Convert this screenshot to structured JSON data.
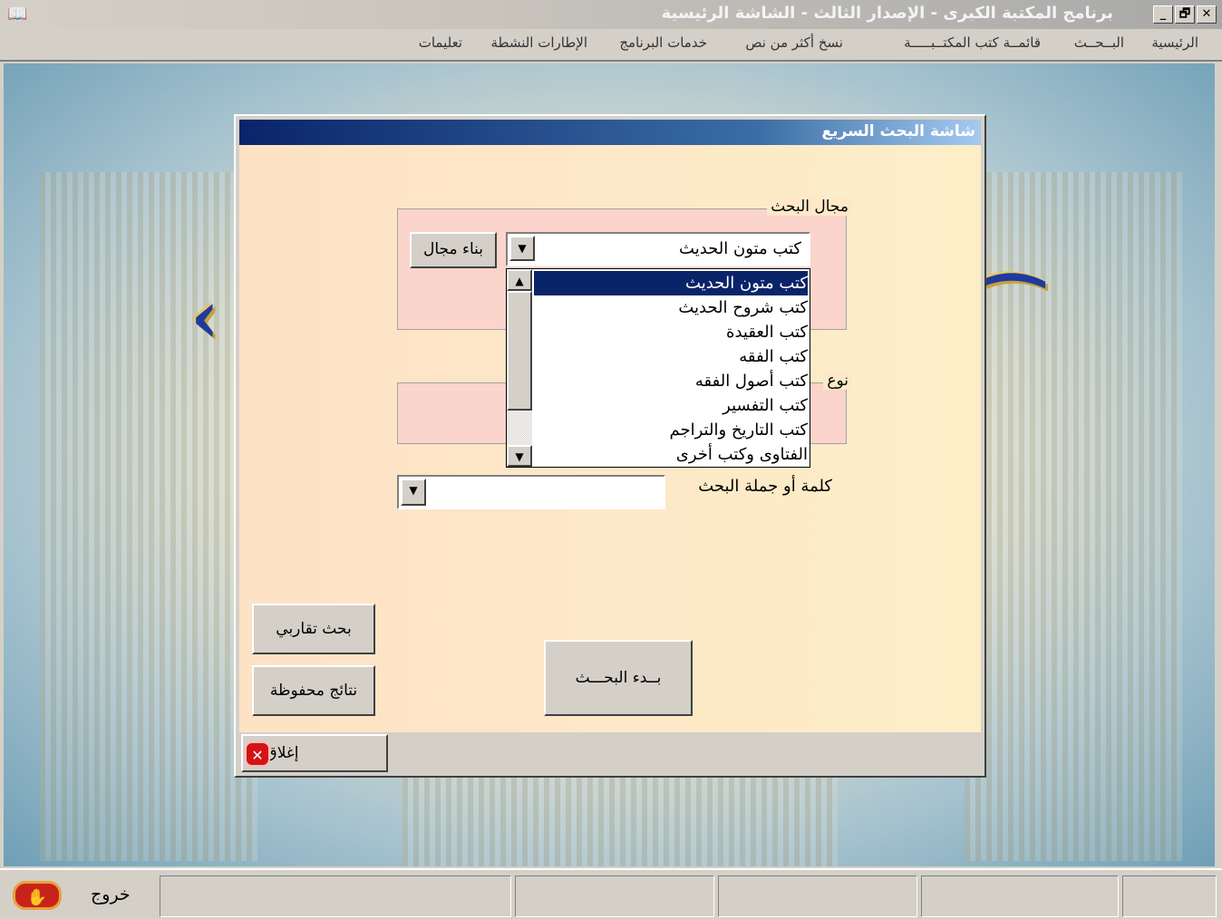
{
  "window": {
    "title": "برنامج المكتبة الكبرى - الإصدار الثالث - الشاشة الرئيسية",
    "icon": "book-icon",
    "controls": {
      "minimize": "_",
      "maximize": "🗗",
      "close": "✕"
    }
  },
  "menu": [
    "الرئيسية",
    "البــحــث",
    "قائمــة كتب المكتــبـــــة",
    "نسخ أكثر من نص",
    "خدمات البرنامج",
    "الإطارات النشطة",
    "تعليمات"
  ],
  "dialog": {
    "title": "شاشة البحث السريع",
    "scope_group": {
      "label": "مجال البحث",
      "selected": "كتب متون الحديث",
      "build_button": "بناء مجال",
      "options": [
        "كتب متون الحديث",
        "كتب شروح الحديث",
        "كتب العقيدة",
        "كتب الفقه",
        "كتب أصول الفقه",
        "كتب التفسير",
        "كتب التاريخ والتراجم",
        "الفتاوى وكتب أخرى"
      ],
      "selected_index": 0
    },
    "type_group": {
      "label": "نوع"
    },
    "search_phrase": {
      "label": "كلمة أو جملة البحث",
      "value": ""
    },
    "buttons": {
      "approximate": "بحث تقاربي",
      "saved_results": "نتائج محفوظة",
      "start": "بــدء البحـــث",
      "close": "إغلاق"
    }
  },
  "statusbar": {
    "exit_label": "خروج"
  },
  "colors": {
    "title_bar": "#0a246a",
    "dialog_body": "#fde9c8",
    "group_bg": "#fbd4cc",
    "selection": "#0a246a"
  }
}
